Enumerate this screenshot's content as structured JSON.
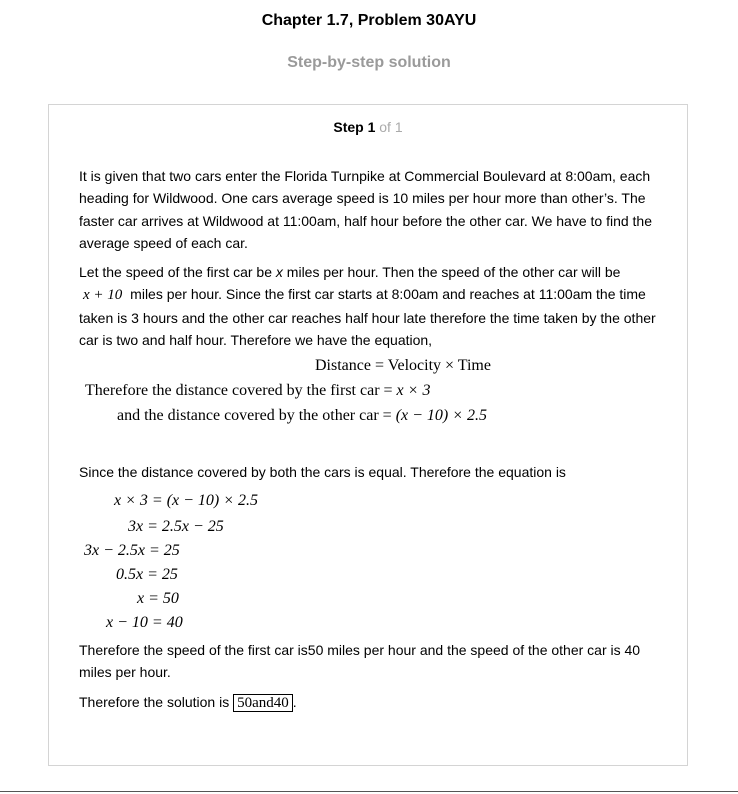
{
  "header": {
    "title": "Chapter 1.7, Problem 30AYU",
    "subtitle": "Step-by-step solution"
  },
  "step": {
    "word": "Step 1",
    "of": "of 1"
  },
  "para1": "It is given that two cars enter the Florida Turnpike at Commercial Boulevard at 8:00am, each heading for Wildwood. One cars average speed is 10 miles per hour more than other’s. The faster car arrives at Wildwood at 11:00am, half hour before the other car. We have to find the average speed of each car.",
  "para2": {
    "a": "Let the speed of the first car be ",
    "var": "x",
    "b": " miles per hour. Then the speed of the other car will be",
    "expr": "x + 10",
    "c": " miles per hour. Since the first car starts at 8:00am and reaches at 11:00am the time taken is 3 hours and the other car reaches half hour late therefore the time taken by the other car is two and half hour. Therefore we have the equation,"
  },
  "eq_block1": {
    "l1": "Distance = Velocity × Time",
    "l2_text": "Therefore the distance covered by the first car = ",
    "l2_math": "x × 3",
    "l3_text": "and the distance covered by the other car = ",
    "l3_math": "(x − 10) × 2.5"
  },
  "para3": "Since the distance covered by both the cars is equal. Therefore the equation is",
  "eq_block2": [
    "x × 3 = (x − 10) × 2.5",
    "3x = 2.5x − 25",
    "3x − 2.5x = 25",
    "0.5x = 25",
    "x = 50",
    "x − 10 = 40"
  ],
  "para4": "Therefore the speed of the first car is50 miles per hour and the speed of the other car is 40 miles per hour.",
  "para5": {
    "text": "Therefore the solution is ",
    "answer": "50and40",
    "end": "."
  }
}
